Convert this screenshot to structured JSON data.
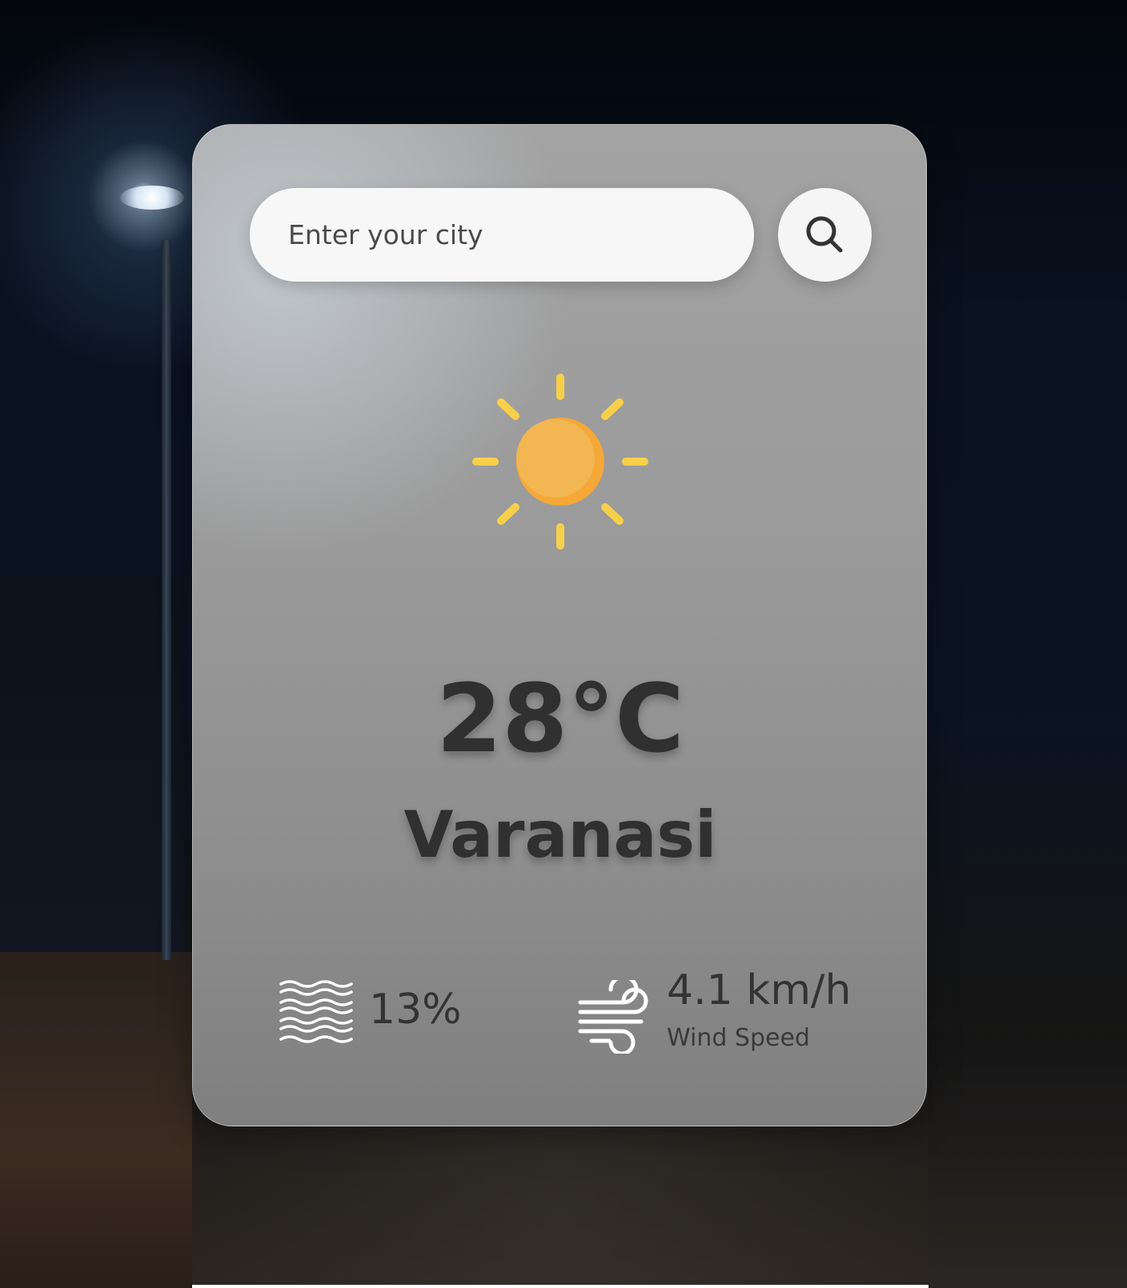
{
  "search": {
    "placeholder": "Enter your city",
    "value": "",
    "button_icon": "search-icon"
  },
  "weather": {
    "icon": "sun-icon",
    "temperature": "28°C",
    "city": "Varanasi",
    "humidity": {
      "icon": "humidity-waves-icon",
      "value": "13%"
    },
    "wind": {
      "icon": "wind-icon",
      "value": "4.1 km/h",
      "label": "Wind Speed"
    }
  },
  "colors": {
    "sun_core": "#F2B652",
    "sun_rays": "#F7D04B",
    "text": "#303030"
  }
}
